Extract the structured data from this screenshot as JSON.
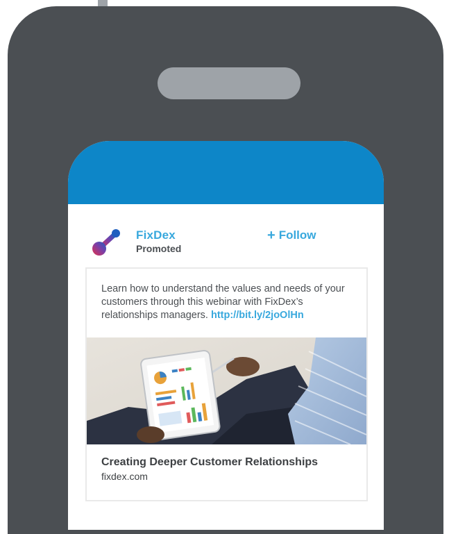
{
  "post": {
    "company_name": "FixDex",
    "sponsored_label": "Promoted",
    "follow_label": "Follow",
    "follow_icon": "plus-icon",
    "body_text": "Learn how to understand the values and needs of your customers through this webinar with FixDex’s relationships managers. ",
    "link_text": "http://bit.ly/2joOlHn",
    "article_title": "Creating Deeper Customer Relationships",
    "article_domain": "fixdex.com"
  },
  "colors": {
    "device_body": "#4b4f53",
    "device_accent": "#9ea3a8",
    "screen_header": "#0d86c8",
    "link": "#38a8dd",
    "text": "#4b4f53"
  }
}
